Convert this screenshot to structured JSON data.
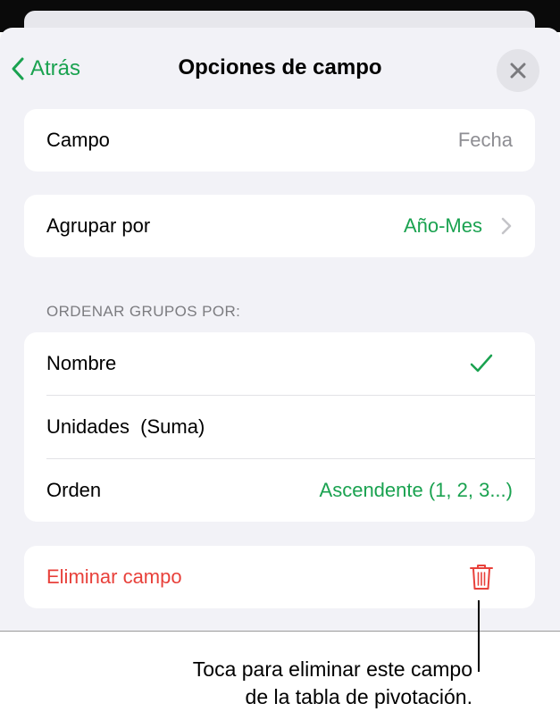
{
  "header": {
    "back_label": "Atrás",
    "title": "Opciones de campo"
  },
  "field_card": {
    "label": "Campo",
    "value": "Fecha"
  },
  "group_card": {
    "label": "Agrupar por",
    "value": "Año-Mes"
  },
  "sort_section": {
    "header": "ORDENAR GRUPOS POR:",
    "rows": [
      {
        "label": "Nombre",
        "selected": true
      },
      {
        "label": "Unidades  (Suma)",
        "selected": false
      },
      {
        "label": "Orden",
        "value": "Ascendente (1, 2, 3...)"
      }
    ]
  },
  "delete_card": {
    "label": "Eliminar campo"
  },
  "callout": {
    "line1": "Toca para eliminar este campo",
    "line2": "de la tabla de pivotación."
  },
  "colors": {
    "accent_green": "#1aa250",
    "destructive_red": "#e8413b",
    "background": "#f2f2f7"
  }
}
